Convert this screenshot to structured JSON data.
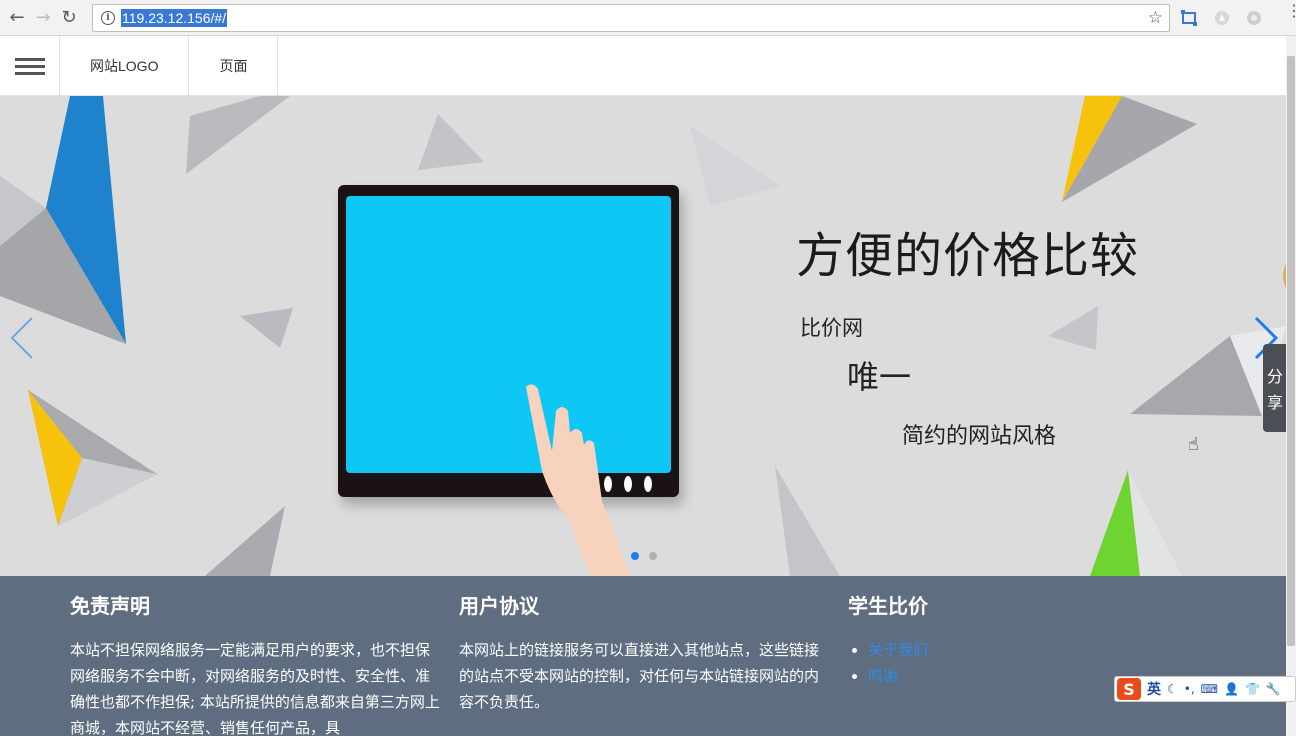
{
  "browser": {
    "url": "119.23.12.156/#/",
    "back": "←",
    "forward": "→",
    "reload": "↻",
    "bookmark": "☆",
    "menu": "⋮"
  },
  "header": {
    "logo": "网站LOGO",
    "page_link": "页面"
  },
  "banner": {
    "headline": "方便的价格比较",
    "sub1": "比价网",
    "sub2": "唯一",
    "sub3": "简约的网站风格",
    "share": [
      "分",
      "享"
    ],
    "slides": 2,
    "active_slide": 1,
    "accent": "#1e7ef0",
    "screen_color": "#0ec7f5"
  },
  "footer": {
    "disclaimer": {
      "title": "免责声明",
      "text": "本站不担保网络服务一定能满足用户的要求，也不担保网络服务不会中断，对网络服务的及时性、安全性、准确性也都不作担保; 本站所提供的信息都来自第三方网上商城，本网站不经营、销售任何产品，具"
    },
    "agreement": {
      "title": "用户协议",
      "text": "本网站上的链接服务可以直接进入其他站点，这些链接的站点不受本网站的控制，对任何与本站链接网站的内容不负责任。"
    },
    "student": {
      "title": "学生比价",
      "links": [
        "关于我们",
        "鸣谢"
      ]
    },
    "bg_color": "#5e6d80"
  },
  "ime": {
    "logo": "S",
    "mode": "英"
  }
}
